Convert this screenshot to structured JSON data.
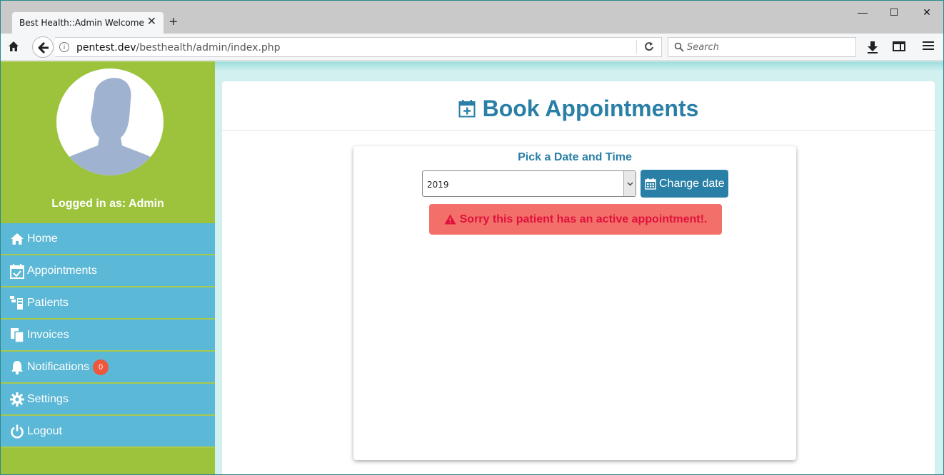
{
  "browser": {
    "tab_title": "Best Health::Admin Welcome",
    "url_host": "pentest.dev",
    "url_path": "/besthealth/admin/index.php",
    "search_placeholder": "Search"
  },
  "sidebar": {
    "logged_in": "Logged in as: Admin",
    "items": [
      {
        "label": "Home",
        "icon": "home-icon"
      },
      {
        "label": "Appointments",
        "icon": "calendar-check-icon"
      },
      {
        "label": "Patients",
        "icon": "patients-icon"
      },
      {
        "label": "Invoices",
        "icon": "copy-icon"
      },
      {
        "label": "Notifications",
        "icon": "bell-icon"
      },
      {
        "label": "Settings",
        "icon": "gear-icon"
      },
      {
        "label": "Logout",
        "icon": "power-icon"
      }
    ],
    "notifications_count": "0"
  },
  "main": {
    "title": "Book Appointments",
    "picker_title": "Pick a Date and Time",
    "year_selected": "2019",
    "change_button": "Change date",
    "alert_text": "Sorry this patient has an active appointment!."
  },
  "colors": {
    "sidebar_green": "#9cc33b",
    "menu_blue": "#5bb8d6",
    "title_blue": "#2a7fa6",
    "alert_bg": "#f3706a",
    "alert_text": "#e0113b",
    "badge_red": "#f0563c"
  }
}
